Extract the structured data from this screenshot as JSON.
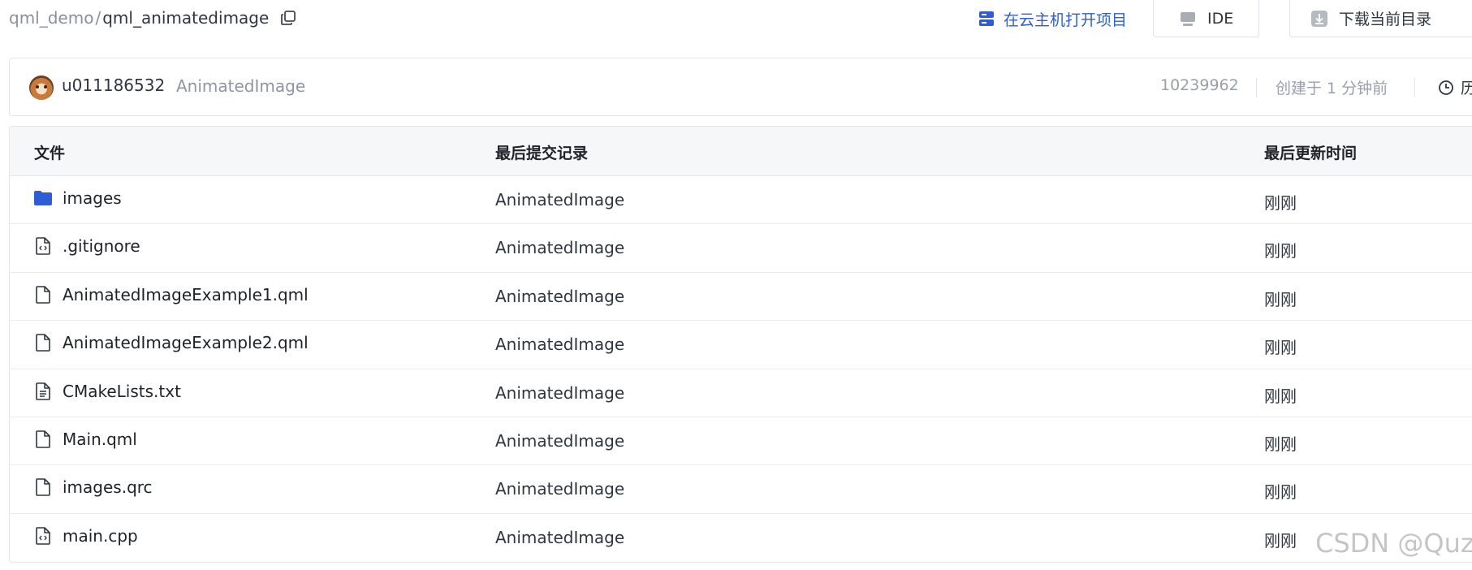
{
  "breadcrumb": {
    "parent": "qml_demo",
    "separator": "/",
    "current": "qml_animatedimage",
    "copy_icon": "copy-icon"
  },
  "actions": {
    "cloud_label": "在云主机打开项目",
    "ide_label": "IDE",
    "download_label": "下载当前目录"
  },
  "commit": {
    "username": "u011186532",
    "message": "AnimatedImage",
    "hash": "10239962",
    "created": "创建于 1 分钟前",
    "history_label": "历"
  },
  "table": {
    "headers": {
      "file": "文件",
      "last_commit": "最后提交记录",
      "updated": "最后更新时间"
    },
    "rows": [
      {
        "name": "images",
        "icon": "folder-icon",
        "commit": "AnimatedImage",
        "time": "刚刚"
      },
      {
        "name": ".gitignore",
        "icon": "code-file-icon",
        "commit": "AnimatedImage",
        "time": "刚刚"
      },
      {
        "name": "AnimatedImageExample1.qml",
        "icon": "file-icon",
        "commit": "AnimatedImage",
        "time": "刚刚"
      },
      {
        "name": "AnimatedImageExample2.qml",
        "icon": "file-icon",
        "commit": "AnimatedImage",
        "time": "刚刚"
      },
      {
        "name": "CMakeLists.txt",
        "icon": "text-file-icon",
        "commit": "AnimatedImage",
        "time": "刚刚"
      },
      {
        "name": "Main.qml",
        "icon": "file-icon",
        "commit": "AnimatedImage",
        "time": "刚刚"
      },
      {
        "name": "images.qrc",
        "icon": "file-icon",
        "commit": "AnimatedImage",
        "time": "刚刚"
      },
      {
        "name": "main.cpp",
        "icon": "code-file-icon",
        "commit": "AnimatedImage",
        "time": "刚刚"
      }
    ]
  },
  "watermark": "CSDN @Quz",
  "colors": {
    "accent": "#2f5dd6",
    "folder": "#2f5dd6",
    "muted": "#8f95a1"
  }
}
